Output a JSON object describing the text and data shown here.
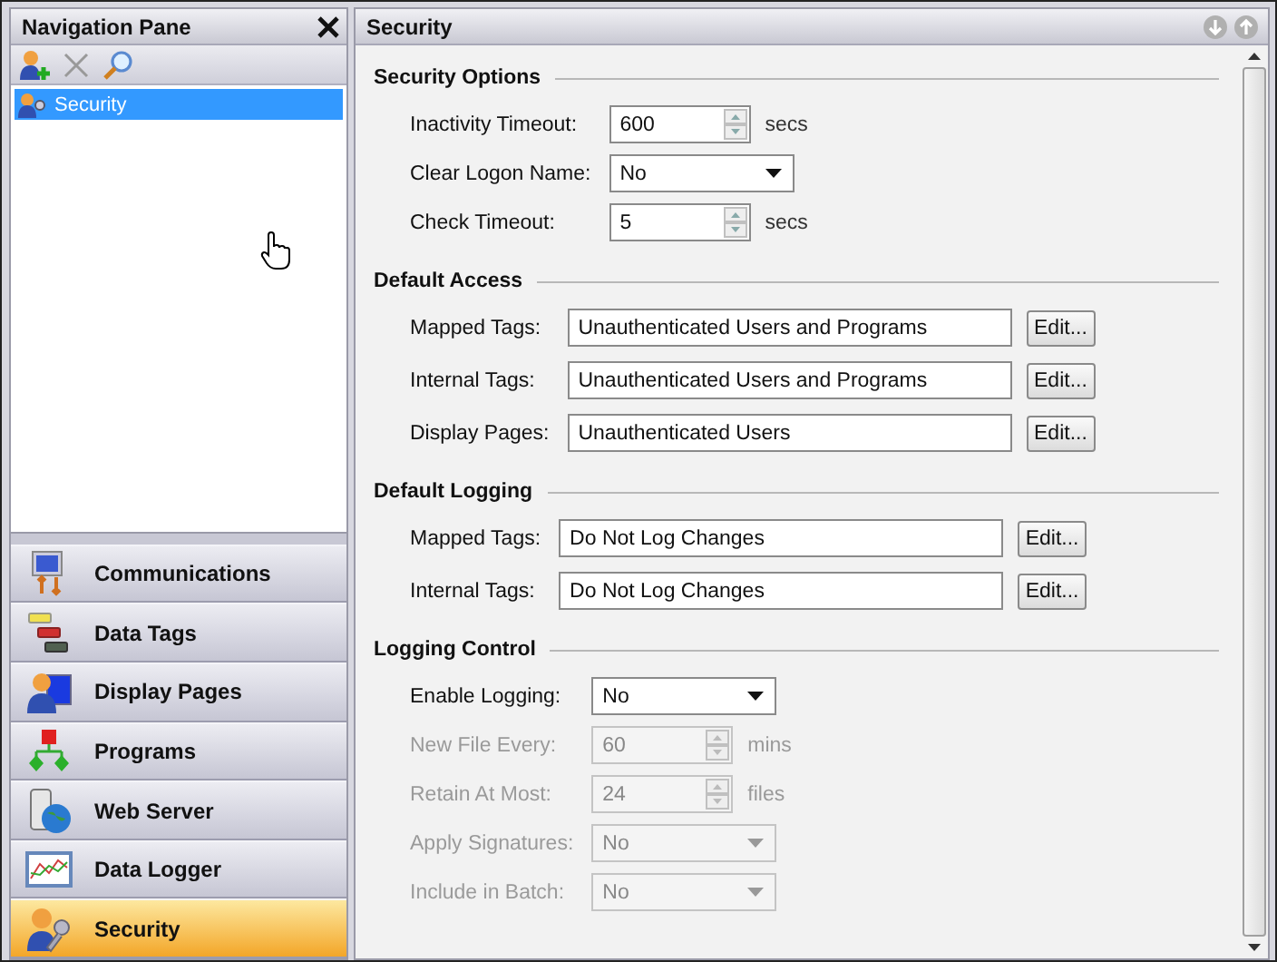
{
  "nav_pane": {
    "title": "Navigation Pane",
    "tree": [
      {
        "label": "Security",
        "selected": true
      }
    ],
    "categories": [
      {
        "kind": "communications",
        "label": "Communications",
        "selected": false
      },
      {
        "kind": "tags",
        "label": "Data Tags",
        "selected": false
      },
      {
        "kind": "pages",
        "label": "Display Pages",
        "selected": false
      },
      {
        "kind": "programs",
        "label": "Programs",
        "selected": false
      },
      {
        "kind": "webserver",
        "label": "Web Server",
        "selected": false
      },
      {
        "kind": "logger",
        "label": "Data Logger",
        "selected": false
      },
      {
        "kind": "security",
        "label": "Security",
        "selected": true
      }
    ]
  },
  "panel": {
    "title": "Security",
    "sections": [
      {
        "title": "Security Options",
        "fields": [
          {
            "kind": "spin",
            "label": "Inactivity Timeout:",
            "value": "600",
            "unit": "secs",
            "disabled": false
          },
          {
            "kind": "select",
            "label": "Clear Logon Name:",
            "value": "No",
            "disabled": false
          },
          {
            "kind": "spin",
            "label": "Check Timeout:",
            "value": "5",
            "unit": "secs",
            "disabled": false
          }
        ]
      },
      {
        "title": "Default Access",
        "fields": [
          {
            "kind": "edit",
            "label": "Mapped Tags:",
            "value": "Unauthenticated Users and Programs",
            "button": "Edit...",
            "disabled": false
          },
          {
            "kind": "edit",
            "label": "Internal Tags:",
            "value": "Unauthenticated Users and Programs",
            "button": "Edit...",
            "disabled": false
          },
          {
            "kind": "edit",
            "label": "Display Pages:",
            "value": "Unauthenticated Users",
            "button": "Edit...",
            "disabled": false
          }
        ]
      },
      {
        "title": "Default Logging",
        "fields": [
          {
            "kind": "edit",
            "label": "Mapped Tags:",
            "value": "Do Not Log Changes",
            "button": "Edit...",
            "disabled": false
          },
          {
            "kind": "edit",
            "label": "Internal Tags:",
            "value": "Do Not Log Changes",
            "button": "Edit...",
            "disabled": false
          }
        ]
      },
      {
        "title": "Logging Control",
        "fields": [
          {
            "kind": "select",
            "label": "Enable Logging:",
            "value": "No",
            "disabled": false
          },
          {
            "kind": "spin",
            "label": "New File Every:",
            "value": "60",
            "unit": "mins",
            "disabled": true
          },
          {
            "kind": "spin",
            "label": "Retain At Most:",
            "value": "24",
            "unit": "files",
            "disabled": true
          },
          {
            "kind": "select",
            "label": "Apply Signatures:",
            "value": "No",
            "disabled": true
          },
          {
            "kind": "select",
            "label": "Include in Batch:",
            "value": "No",
            "disabled": true
          }
        ]
      }
    ]
  }
}
